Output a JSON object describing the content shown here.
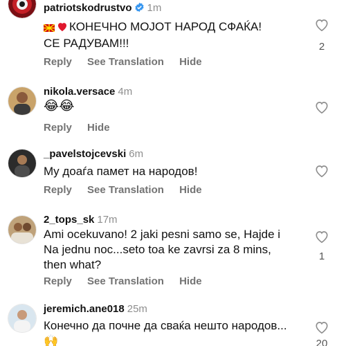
{
  "comments": [
    {
      "username": "patriotskodrustvo",
      "verified": true,
      "time": "1m",
      "text_line1": "КОНЕЧНО МОЈОТ НАРОД СФАЌА!",
      "text_line2": "СЕ РАДУВАМ!!!",
      "actions": {
        "reply": "Reply",
        "translate": "See Translation",
        "hide": "Hide"
      },
      "likes": "2"
    },
    {
      "username": "nikola.versace",
      "time": "4m",
      "text": "😂😂",
      "actions": {
        "reply": "Reply",
        "hide": "Hide"
      },
      "likes": ""
    },
    {
      "username": "_pavelstojcevski",
      "time": "6m",
      "text": "My доаѓа памет на народов!",
      "actions": {
        "reply": "Reply",
        "translate": "See Translation",
        "hide": "Hide"
      },
      "likes": ""
    },
    {
      "username": "2_tops_sk",
      "time": "17m",
      "text_line1": "Ami ocekuvano! 2 jaki pesni samo se, Hajde i",
      "text_line2": "Na jednu noc...seto toa ke zavrsi za 8 mins,",
      "text_line3": "then what?",
      "actions": {
        "reply": "Reply",
        "translate": "See Translation",
        "hide": "Hide"
      },
      "likes": "1"
    },
    {
      "username": "jeremich.ane018",
      "time": "25m",
      "text_line1": "Конечно да почне да сваќа нешто народов...",
      "text_line2": "🙌",
      "likes": "20"
    }
  ],
  "colors": {
    "verified": "#3897f0",
    "muted": "#737373",
    "heart_outline": "#8e8e8e"
  },
  "icons": [
    "verified-badge-icon",
    "heart-icon",
    "macedonia-flag-icon",
    "red-heart-icon"
  ]
}
